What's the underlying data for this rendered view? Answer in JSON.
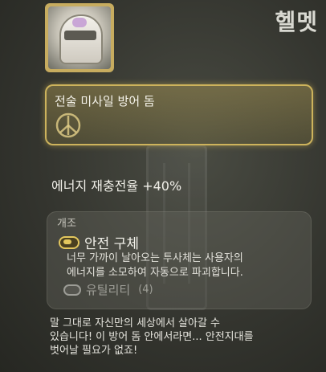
{
  "item": {
    "title": "헬멧",
    "icon": "helmet-icon"
  },
  "perk": {
    "label": "전술 미사일 방어 돔",
    "icon": "perk-emblem-icon"
  },
  "stat": {
    "text": "에너지 재충전율 +40%"
  },
  "mod": {
    "header": "개조",
    "name": "안전 구체",
    "description_line1": "너무 가까이 날아오는 투사체는 사용자의",
    "description_line2": "에너지를 소모하여 자동으로 파괴합니다.",
    "utility_label": "유틸리티",
    "utility_count": "(4)"
  },
  "lore": {
    "line1": "말 그대로 자신만의 세상에서 살아갈 수",
    "line2": "있습니다! 이 방어 돔 안에서라면... 안전지대를",
    "line3": "벗어날 필요가 없죠!"
  },
  "colors": {
    "accent_gold": "#cdb35c",
    "mod_gold": "#e3c75e"
  }
}
